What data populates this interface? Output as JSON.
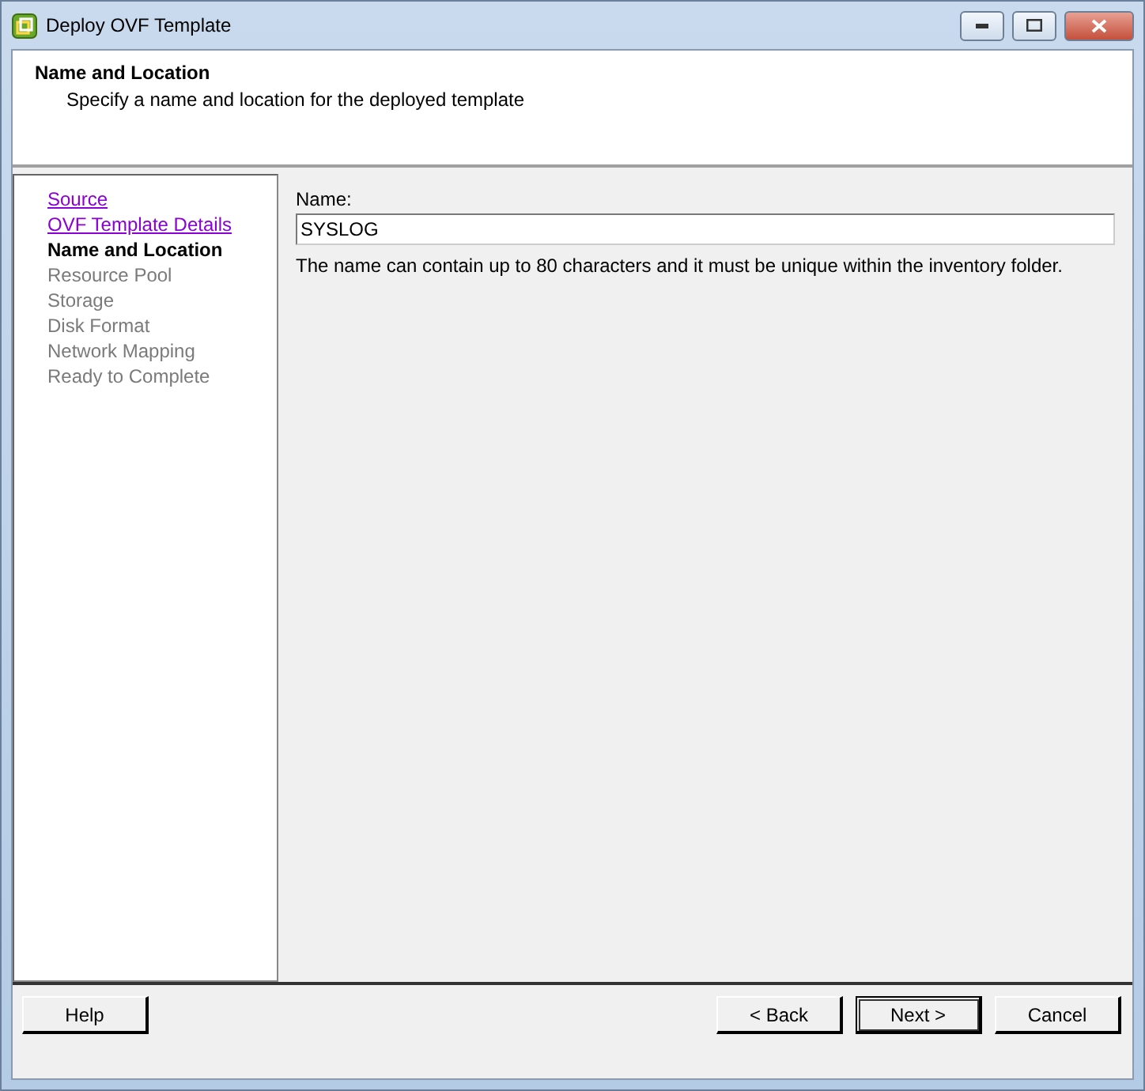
{
  "window": {
    "title": "Deploy OVF Template"
  },
  "header": {
    "title": "Name and Location",
    "subtitle": "Specify a name and location for the deployed template"
  },
  "steps": [
    {
      "label": "Source",
      "kind": "visited"
    },
    {
      "label": "OVF Template Details",
      "kind": "visited"
    },
    {
      "label": "Name and Location",
      "kind": "current"
    },
    {
      "label": "Resource Pool",
      "kind": "pending"
    },
    {
      "label": "Storage",
      "kind": "pending"
    },
    {
      "label": "Disk Format",
      "kind": "pending"
    },
    {
      "label": "Network Mapping",
      "kind": "pending"
    },
    {
      "label": "Ready to Complete",
      "kind": "pending"
    }
  ],
  "form": {
    "label": "Name:",
    "value": "SYSLOG",
    "hint": "The name can contain up to 80 characters and it must be unique within the inventory folder."
  },
  "buttons": [
    {
      "label": "Help",
      "kind": "plain"
    },
    {
      "label": "< Back",
      "kind": "plain"
    },
    {
      "label": "Next >",
      "kind": "default"
    },
    {
      "label": "Cancel",
      "kind": "plain"
    }
  ]
}
